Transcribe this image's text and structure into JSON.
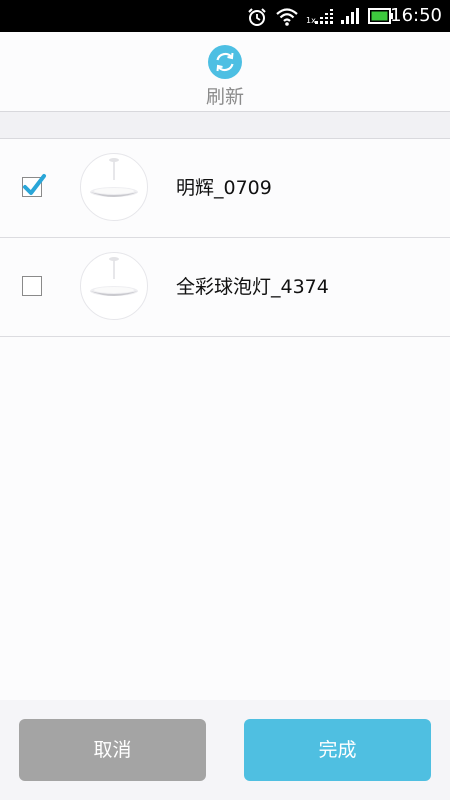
{
  "status_bar": {
    "time": "16:50",
    "network_label": "1x",
    "icons": [
      "alarm-icon",
      "wifi-icon",
      "signal-1x-icon",
      "signal-icon",
      "battery-icon"
    ]
  },
  "header": {
    "refresh_label": "刷新",
    "refresh_icon": "refresh-icon",
    "accent_color": "#4dbfe3"
  },
  "devices": [
    {
      "name": "明辉_0709",
      "checked": true,
      "thumbnail_icon": "pendant-lamp-icon"
    },
    {
      "name": "全彩球泡灯_4374",
      "checked": false,
      "thumbnail_icon": "pendant-lamp-icon"
    }
  ],
  "footer": {
    "cancel_label": "取消",
    "done_label": "完成",
    "cancel_color": "#a4a4a4",
    "done_color": "#4fbfe1"
  }
}
